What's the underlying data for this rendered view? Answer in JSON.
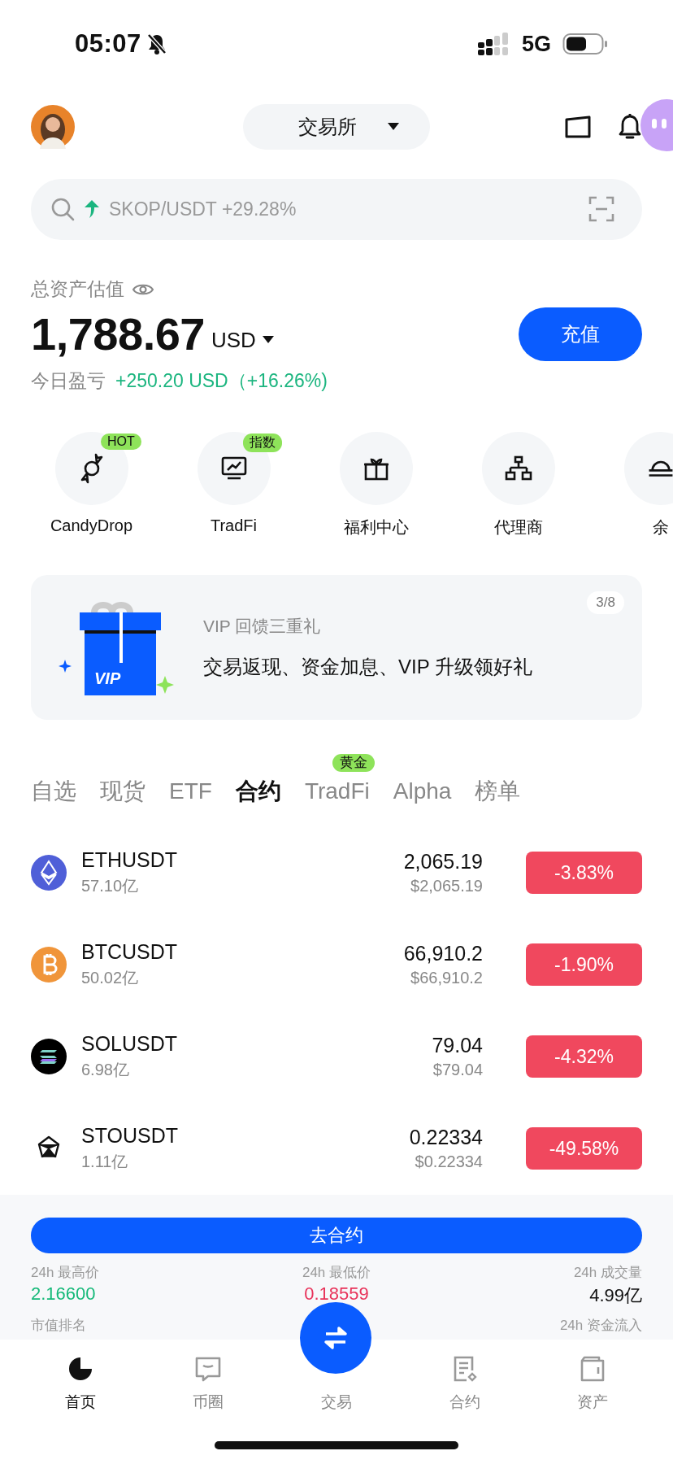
{
  "status_bar": {
    "time": "05:07",
    "network": "5G"
  },
  "header": {
    "exchange_selector": "交易所"
  },
  "search": {
    "placeholder": "SKOP/USDT +29.28%"
  },
  "assets": {
    "label": "总资产估值",
    "amount": "1,788.67",
    "currency": "USD",
    "deposit_button": "充值",
    "pnl_label": "今日盈亏",
    "pnl_value": "+250.20 USD（+16.26%)"
  },
  "shortcuts": [
    {
      "label": "CandyDrop",
      "badge": "HOT"
    },
    {
      "label": "TradFi",
      "badge": "指数"
    },
    {
      "label": "福利中心"
    },
    {
      "label": "代理商"
    },
    {
      "label": "余"
    }
  ],
  "banner": {
    "gift_label": "VIP",
    "title": "VIP 回馈三重礼",
    "text": "交易返现、资金加息、VIP 升级领好礼",
    "pager": "3/8"
  },
  "market_tabs": [
    {
      "label": "自选",
      "selected": false
    },
    {
      "label": "现货",
      "selected": false
    },
    {
      "label": "ETF",
      "selected": false
    },
    {
      "label": "合约",
      "selected": true
    },
    {
      "label": "TradFi",
      "selected": false,
      "badge": "黄金"
    },
    {
      "label": "Alpha",
      "selected": false
    },
    {
      "label": "榜单",
      "selected": false
    }
  ],
  "pairs": [
    {
      "symbol": "ETHUSDT",
      "volume": "57.10亿",
      "price": "2,065.19",
      "price_usd": "$2,065.19",
      "change": "-3.83%"
    },
    {
      "symbol": "BTCUSDT",
      "volume": "50.02亿",
      "price": "66,910.2",
      "price_usd": "$66,910.2",
      "change": "-1.90%"
    },
    {
      "symbol": "SOLUSDT",
      "volume": "6.98亿",
      "price": "79.04",
      "price_usd": "$79.04",
      "change": "-4.32%"
    },
    {
      "symbol": "STOUSDT",
      "volume": "1.11亿",
      "price": "0.22334",
      "price_usd": "$0.22334",
      "change": "-49.58%"
    }
  ],
  "contract_panel": {
    "button": "去合约",
    "stats": [
      {
        "label": "24h 最高价",
        "value": "2.16600",
        "color": "#16b979"
      },
      {
        "label": "24h 最低价",
        "value": "0.18559",
        "color": "#e8335a"
      },
      {
        "label": "24h 成交量",
        "value": "4.99亿",
        "color": "#111111"
      }
    ],
    "more_labels": [
      "市值排名",
      "24h 资金流入"
    ]
  },
  "nav": [
    {
      "label": "首页",
      "kind": "tab",
      "selected": true
    },
    {
      "label": "币圈",
      "kind": "tab",
      "selected": false
    },
    {
      "label": "交易",
      "kind": "action",
      "selected": false
    },
    {
      "label": "合约",
      "kind": "tab",
      "selected": false
    },
    {
      "label": "资产",
      "kind": "tab",
      "selected": false
    }
  ]
}
